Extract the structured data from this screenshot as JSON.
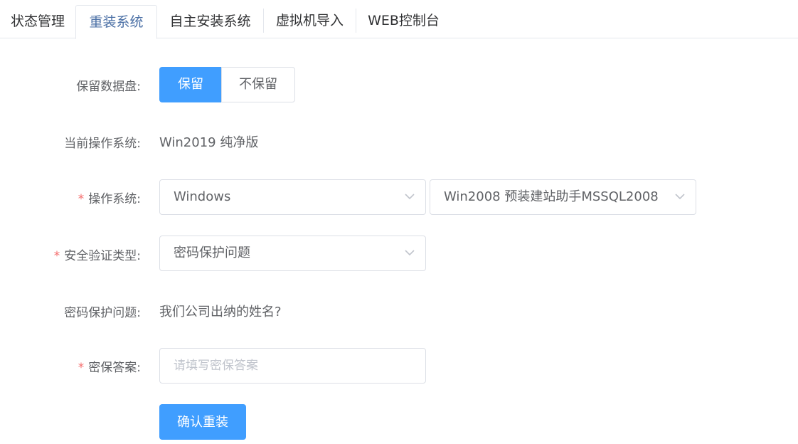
{
  "tabs": [
    {
      "label": "状态管理"
    },
    {
      "label": "重装系统",
      "active": true
    },
    {
      "label": "自主安装系统"
    },
    {
      "label": "虚拟机导入"
    },
    {
      "label": "WEB控制台"
    }
  ],
  "form": {
    "keep_data_disk": {
      "label": "保留数据盘:",
      "options": [
        "保留",
        "不保留"
      ],
      "selected": "保留"
    },
    "current_os": {
      "label": "当前操作系统:",
      "value": "Win2019 纯净版"
    },
    "os": {
      "required_mark": "*",
      "label": "操作系统:",
      "family": "Windows",
      "version": "Win2008 预装建站助手MSSQL2008"
    },
    "security_type": {
      "required_mark": "*",
      "label": "安全验证类型:",
      "value": "密码保护问题"
    },
    "security_question": {
      "label": "密码保护问题:",
      "value": "我们公司出纳的姓名?"
    },
    "answer": {
      "required_mark": "*",
      "label": "密保答案:",
      "placeholder": "请填写密保答案",
      "value": ""
    },
    "submit_label": "确认重装"
  },
  "colors": {
    "primary": "#409eff",
    "required": "#f56c6c",
    "active_tab": "#4a6fa5"
  }
}
